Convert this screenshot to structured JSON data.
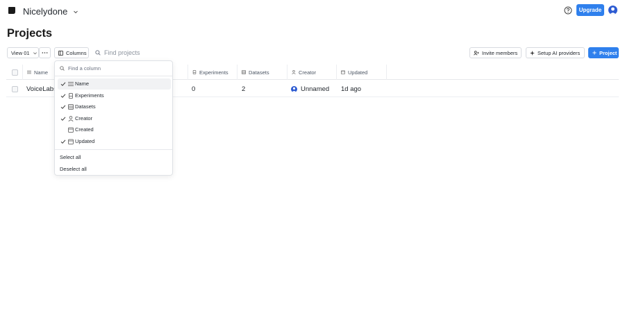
{
  "app": {
    "org_name": "Nicelydone",
    "upgrade_label": "Upgrade"
  },
  "page": {
    "title": "Projects"
  },
  "toolbar": {
    "view_label": "View 01",
    "columns_label": "Columns",
    "search_placeholder": "Find projects",
    "invite_label": "Invite members",
    "ai_label": "Setup AI providers",
    "project_label": "Project"
  },
  "table": {
    "headers": {
      "name": "Name",
      "experiments": "Experiments",
      "datasets": "Datasets",
      "creator": "Creator",
      "updated": "Updated"
    },
    "rows": [
      {
        "name": "VoiceLabs",
        "experiments": "0",
        "datasets": "2",
        "creator": "Unnamed",
        "updated": "1d ago"
      }
    ]
  },
  "column_menu": {
    "search_placeholder": "Find a column",
    "items": [
      {
        "label": "Name",
        "checked": true,
        "icon": "list-icon"
      },
      {
        "label": "Experiments",
        "checked": true,
        "icon": "beaker-icon"
      },
      {
        "label": "Datasets",
        "checked": true,
        "icon": "database-icon"
      },
      {
        "label": "Creator",
        "checked": true,
        "icon": "person-icon"
      },
      {
        "label": "Created",
        "checked": false,
        "icon": "calendar-icon"
      },
      {
        "label": "Updated",
        "checked": true,
        "icon": "calendar-icon"
      }
    ],
    "select_all": "Select all",
    "deselect_all": "Deselect all"
  },
  "colors": {
    "accent": "#2f80ed",
    "avatar": "#2d5bd2",
    "border": "#d8dbe0"
  }
}
